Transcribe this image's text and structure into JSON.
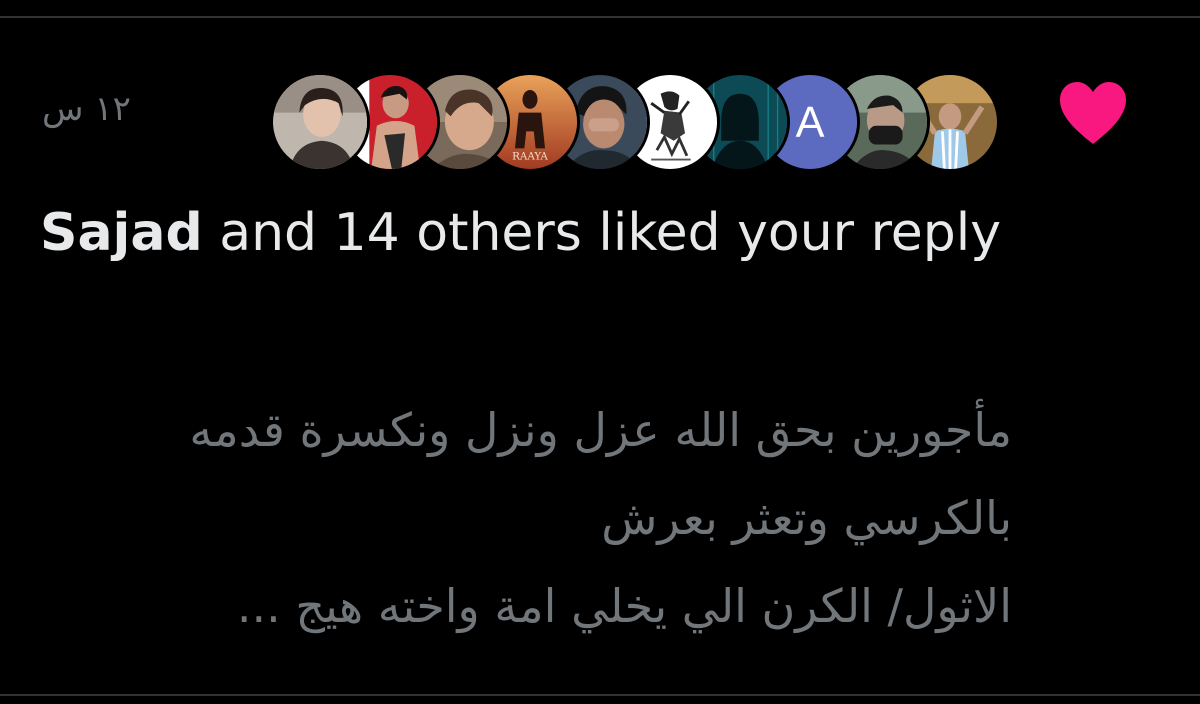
{
  "notification": {
    "timestamp": "١٢ س",
    "actor_name": "Sajad",
    "action_text": " and 14 others liked your reply",
    "reply_lines": [
      "مأجورين بحق الله عزل ونزل ونكسرة قدمه",
      "بالكرسي وتعثر بعرش",
      "الاثول/ الكرن الي يخلي امة واخته هيج ..."
    ],
    "avatars": [
      {
        "icon": "avatar-photo-woman-icon",
        "bg": "#bfb6ad"
      },
      {
        "icon": "avatar-photo-athlete-icon",
        "bg": "#c9202c"
      },
      {
        "icon": "avatar-photo-man-icon",
        "bg": "#7a6a5c"
      },
      {
        "icon": "avatar-photo-poster-icon",
        "bg": "#c96a3a",
        "caption": "RAAYA"
      },
      {
        "icon": "avatar-photo-man-dark-icon",
        "bg": "#3a4a5a"
      },
      {
        "icon": "avatar-sketch-icon",
        "bg": "#ffffff"
      },
      {
        "icon": "avatar-hacker-icon",
        "bg": "#0c4a55"
      },
      {
        "icon": "avatar-letter-icon",
        "bg": "#5c6bc0",
        "letter": "A"
      },
      {
        "icon": "avatar-photo-masked-icon",
        "bg": "#5a6a5a"
      },
      {
        "icon": "avatar-photo-fan-icon",
        "bg": "#8a6a3a"
      }
    ],
    "like_icon": "heart-icon",
    "like_color": "#f91880"
  }
}
